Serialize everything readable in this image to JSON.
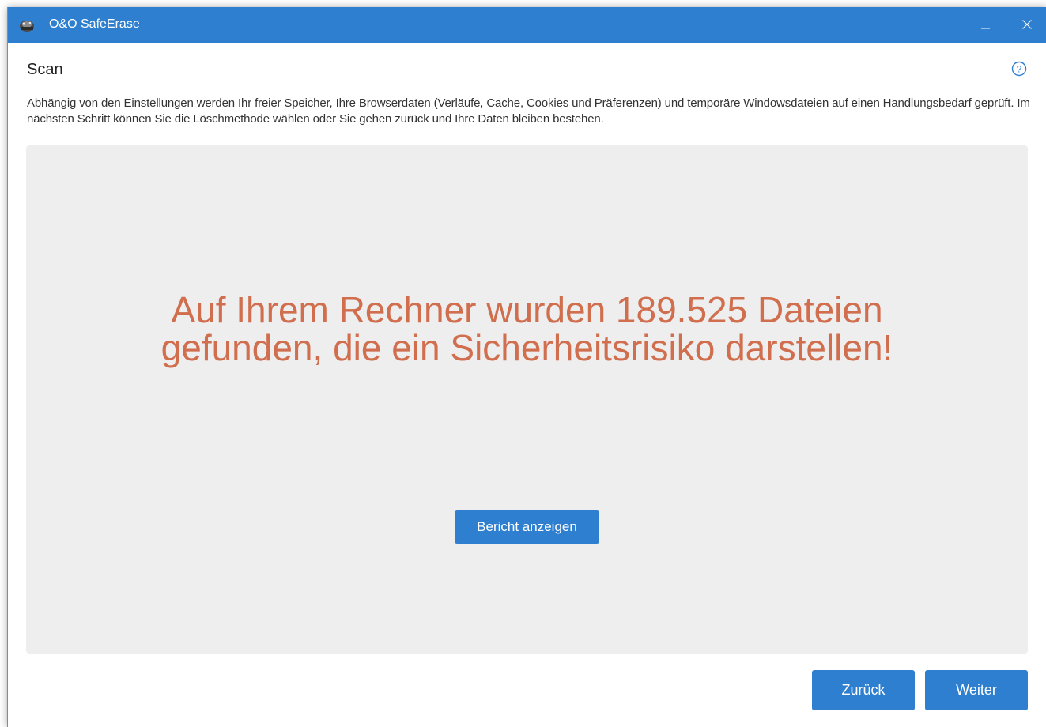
{
  "window": {
    "title": "O&O SafeErase",
    "title_bar_color": "#2e7fcf",
    "app_icon": "safeerase-app-icon",
    "minimize_icon": "minimize-icon",
    "close_icon": "close-icon"
  },
  "page": {
    "title": "Scan",
    "help_icon": "help-icon",
    "description": "Abhängig von den Einstellungen werden Ihr freier Speicher, Ihre Browserdaten (Verläufe, Cache, Cookies und Präferenzen) und temporäre Windowsdateien auf einen Handlungsbedarf geprüft. Im nächsten Schritt können Sie die Löschmethode wählen oder Sie gehen zurück und Ihre Daten bleiben bestehen."
  },
  "result": {
    "message_line1": "Auf Ihrem Rechner wurden 189.525 Dateien",
    "message_line2": "gefunden, die ein Sicherheitsrisiko darstellen!",
    "message_color": "#d06e4e",
    "panel_color": "#eeeeee",
    "report_button_label": "Bericht anzeigen"
  },
  "footer": {
    "back_label": "Zurück",
    "next_label": "Weiter"
  },
  "colors": {
    "accent": "#2e7fcf",
    "warning_text": "#d06e4e"
  }
}
